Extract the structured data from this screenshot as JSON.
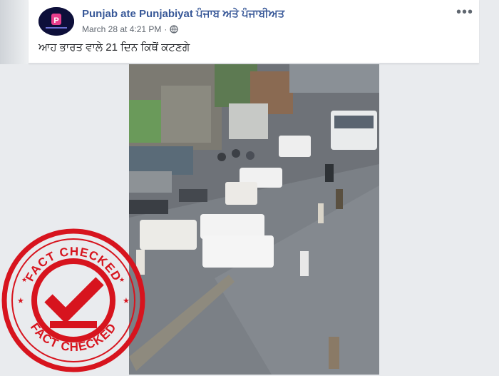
{
  "post": {
    "page_name": "Punjab ate Punjabiyat ਪੰਜਾਬ ਅਤੇ ਪੰਜਾਬੀਅਤ",
    "timestamp": "March 28 at 4:21 PM",
    "separator": "·",
    "caption": "ਆਹ ਭਾਰਤ ਵਾਲੇ 21 ਦਿਨ ਕਿਥੋਂ ਕਟਣਗੇ",
    "more_label": "•••",
    "avatar_icon": "punjab-logo-icon",
    "privacy_icon": "globe-icon"
  },
  "stamp": {
    "top_text": "FACT CHECKED",
    "bottom_text": "FACT CHECKED",
    "color": "#d7141e"
  },
  "colors": {
    "page_name": "#385898",
    "background": "#e9ebee"
  }
}
